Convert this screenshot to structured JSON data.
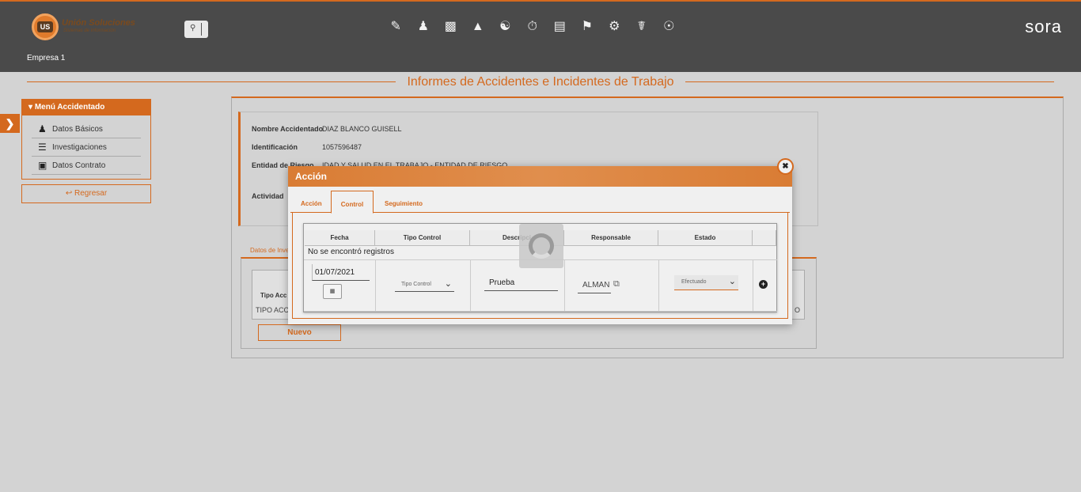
{
  "header": {
    "logo_name": "Unión Soluciones",
    "logo_subtitle": "Sistemas de Información",
    "logo_badge": "US",
    "company": "Empresa 1",
    "brand": "sora",
    "nav_icons": [
      "report-icon",
      "worker-icon",
      "gift-icon",
      "org-chart-icon",
      "user-badge-icon",
      "stopwatch-icon",
      "document-list-icon",
      "training-icon",
      "gears-icon",
      "medical-case-icon",
      "users-group-icon"
    ]
  },
  "page": {
    "title": "Informes de Accidentes e Incidentes de Trabajo"
  },
  "menu": {
    "title": "Menú Accidentado",
    "items": [
      {
        "label": "Datos Básicos",
        "icon": "user-icon"
      },
      {
        "label": "Investigaciones",
        "icon": "list-icon"
      },
      {
        "label": "Datos Contrato",
        "icon": "clipboard-icon"
      }
    ],
    "back_label": "Regresar"
  },
  "info": {
    "rows": [
      {
        "label": "Nombre Accidentado",
        "value": "DIAZ BLANCO GUISELL"
      },
      {
        "label": "Identificación",
        "value": "1057596487"
      },
      {
        "label": "Entidad de Riesgo",
        "value": "IDAD Y SALUD EN EL TRABAJO - ENTIDAD DE RIESGO"
      },
      {
        "label": "Actividad",
        "value": ""
      }
    ]
  },
  "investigation": {
    "tab_label": "Datos de Inve",
    "column_header": "Tipo Acc",
    "cell_value": "TIPO ACC",
    "cell_value_right": "O",
    "new_button": "Nuevo"
  },
  "modal": {
    "title": "Acción",
    "tabs": [
      "Acción",
      "Control",
      "Seguimiento"
    ],
    "active_tab": "Control",
    "table": {
      "columns": [
        "Fecha",
        "Tipo Control",
        "Descripci",
        "Responsable",
        "Estado"
      ],
      "empty_text": "No se encontró registros",
      "form": {
        "date": "01/07/2021",
        "tipo_control_placeholder": "Tipo Control",
        "descripcion": "Prueba",
        "responsable": "ALMAN",
        "estado": "Efectuado"
      }
    }
  },
  "colors": {
    "accent": "#d4691e",
    "header_bg": "#4a4a4a",
    "page_bg": "#d3d3d3"
  }
}
